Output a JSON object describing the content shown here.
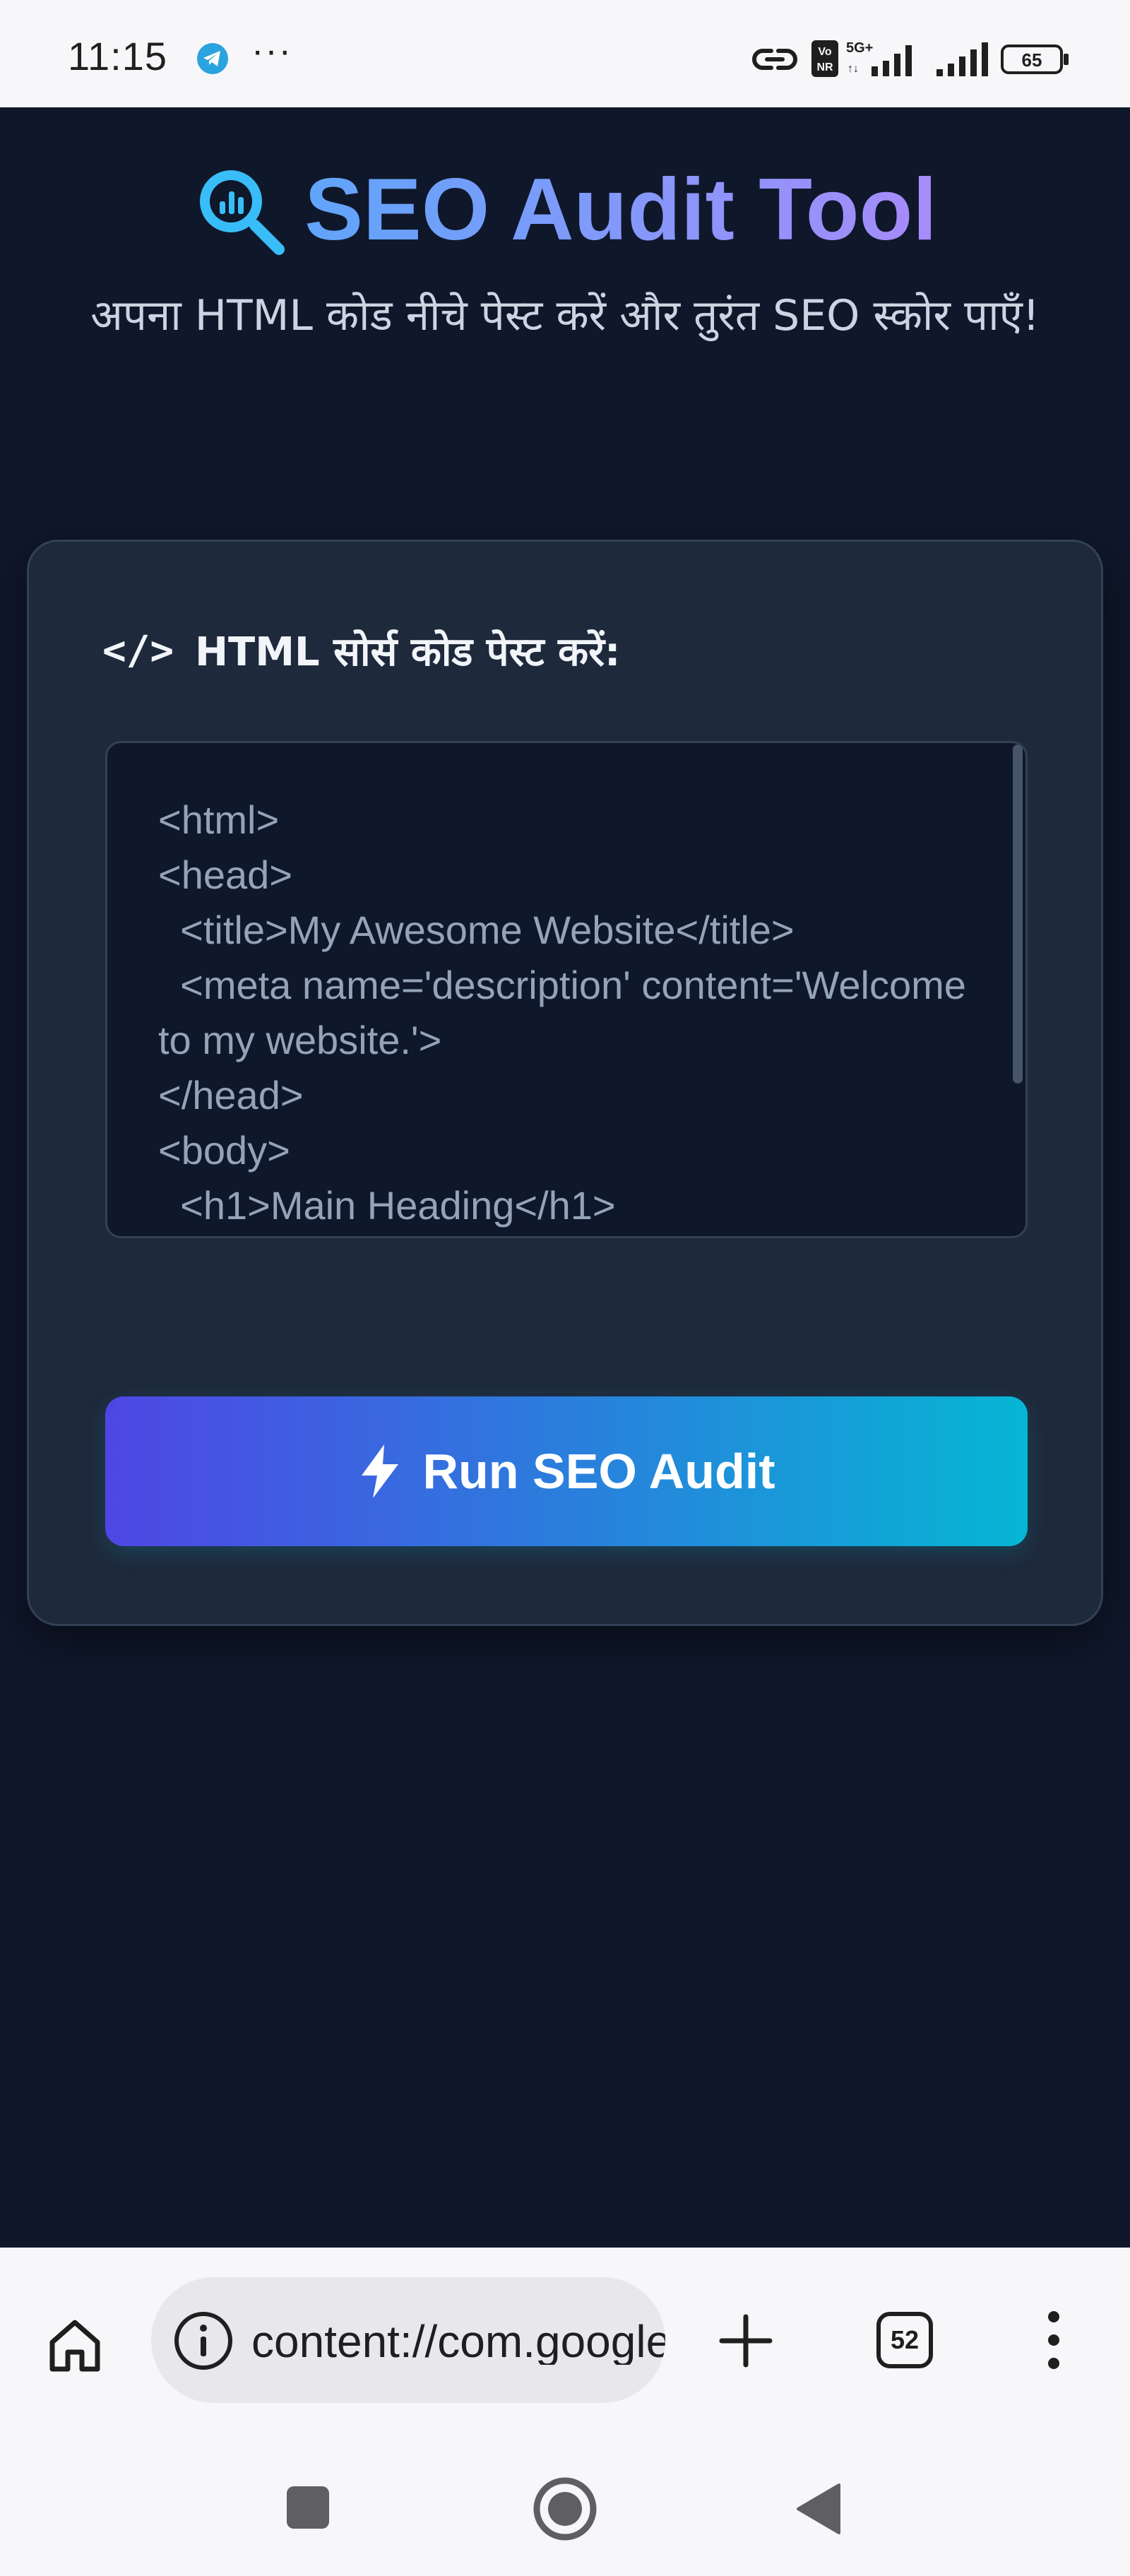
{
  "status_bar": {
    "time": "11:15",
    "more": "···",
    "battery": "65",
    "network": "5G+",
    "volte_badge_top": "Vo",
    "volte_badge_bottom": "NR"
  },
  "app": {
    "title": "SEO Audit Tool",
    "subtitle": "अपना HTML कोड नीचे पेस्ट करें और तुरंत SEO स्कोर पाएँ!",
    "input_section": {
      "icon": "</>",
      "label": "HTML सोर्स कोड पेस्ट करें:",
      "placeholder": "<html>\n<head>\n  <title>My Awesome Website</title>\n  <meta name='description' content='Welcome to my website.'>\n</head>\n<body>\n  <h1>Main Heading</h1>"
    },
    "run_button": {
      "label": "Run SEO Audit"
    }
  },
  "browser": {
    "address": "content://com.google.android.apps.nbu.files.provider",
    "tab_count": "52"
  },
  "colors": {
    "background": "#0f172a",
    "card": "#1e293b",
    "title_gradient_start": "#60a5fa",
    "title_gradient_end": "#a78bfa",
    "button_gradient_start": "#4f46e5",
    "button_gradient_end": "#06b6d4",
    "search_icon": "#38bdf8"
  },
  "icons": {
    "search": "magnifier-chart-icon",
    "code": "code-brackets-icon",
    "bolt": "lightning-bolt-icon",
    "home": "home-icon",
    "info": "info-icon",
    "new_tab": "plus-icon",
    "menu": "kebab-menu-icon"
  }
}
